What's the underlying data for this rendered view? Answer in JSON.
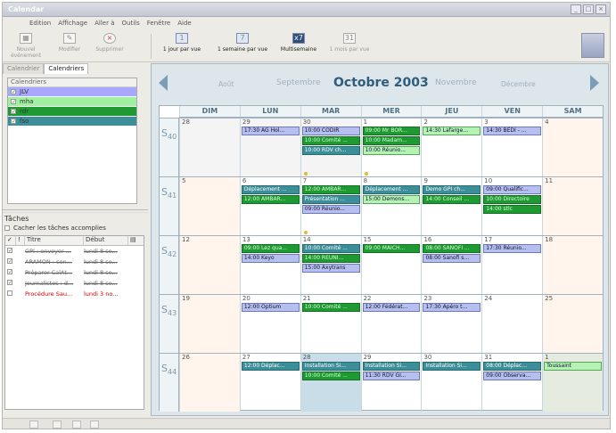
{
  "window": {
    "title": "Calendar"
  },
  "menu": [
    "Edition",
    "Affichage",
    "Aller à",
    "Outils",
    "Fenêtre",
    "Aide"
  ],
  "toolbar": {
    "new_event": "Nouvel événement",
    "modify": "Modifier",
    "delete": "Supprimer",
    "day_view": "1 jour par vue",
    "week_view": "1 semaine par vue",
    "multiweek": "Multisemaine",
    "month_view": "1 mois par vue"
  },
  "left_tabs": [
    "Calendrier",
    "Calendriers"
  ],
  "calendars": {
    "header": "Calendriers",
    "items": [
      {
        "name": "JLV",
        "color": "#a8a8ff",
        "checked": true
      },
      {
        "name": "mha",
        "color": "#9ff09f",
        "checked": true
      },
      {
        "name": "rdr",
        "color": "#1f9a33",
        "checked": true
      },
      {
        "name": "fso",
        "color": "#3c8f98",
        "checked": true
      }
    ]
  },
  "tasks": {
    "header": "Tâches",
    "hide_completed": "Cacher les tâches accomplies",
    "columns": {
      "priority": "!",
      "title": "Titre",
      "start": "Début"
    },
    "rows": [
      {
        "title": "GPI : envoyer ...",
        "start": "lundi 8 se...",
        "done": true,
        "late": false
      },
      {
        "title": "ARAMON : con...",
        "start": "lundi 8 se...",
        "done": true,
        "late": false
      },
      {
        "title": "Préparer CalAt...",
        "start": "lundi 8 se...",
        "done": true,
        "late": false
      },
      {
        "title": "Journalistes : d...",
        "start": "lundi 8 se...",
        "done": true,
        "late": false
      },
      {
        "title": "Procédure Sau...",
        "start": "lundi 3 no...",
        "done": false,
        "late": true
      }
    ]
  },
  "calendar": {
    "months": {
      "prev2": "Août",
      "prev1": "Septembre",
      "current": "Octobre 2003",
      "next1": "Novembre",
      "next2": "Décembre"
    },
    "days": [
      "DIM",
      "LUN",
      "MAR",
      "MER",
      "JEU",
      "VEN",
      "SAM"
    ],
    "weeks": [
      {
        "label": "S",
        "num": "40",
        "cells": [
          {
            "d": "28",
            "cls": "other",
            "ev": []
          },
          {
            "d": "29",
            "cls": "other",
            "ev": [
              {
                "t": "17:30 AG Hol...",
                "c": "b"
              }
            ]
          },
          {
            "d": "30",
            "cls": "other",
            "ev": [
              {
                "t": "10:00 CODIR",
                "c": "b"
              },
              {
                "t": "10:00 Comité ...",
                "c": "g"
              },
              {
                "t": "10:00 RDV ch...",
                "c": "t"
              }
            ],
            "dot": true
          },
          {
            "d": "1",
            "cls": "",
            "ev": [
              {
                "t": "09:00 Mr BOR...",
                "c": "g"
              },
              {
                "t": "10:00 Madam...",
                "c": "g"
              },
              {
                "t": "10:00 Réunio...",
                "c": "lg"
              }
            ],
            "dot": true
          },
          {
            "d": "2",
            "cls": "",
            "ev": [
              {
                "t": "14:30 Lafarge...",
                "c": "lg"
              }
            ]
          },
          {
            "d": "3",
            "cls": "",
            "ev": [
              {
                "t": "14:30 BEDI - ...",
                "c": "b"
              }
            ]
          },
          {
            "d": "4",
            "cls": "wknd",
            "ev": []
          }
        ]
      },
      {
        "label": "S",
        "num": "41",
        "cells": [
          {
            "d": "5",
            "cls": "wknd",
            "ev": []
          },
          {
            "d": "6",
            "cls": "",
            "ev": [
              {
                "t": "Déplacement ...",
                "c": "t"
              },
              {
                "t": "12:00 AMBAR...",
                "c": "g"
              }
            ]
          },
          {
            "d": "7",
            "cls": "",
            "ev": [
              {
                "t": "12:00 AMBAR...",
                "c": "g"
              },
              {
                "t": "Présentation ...",
                "c": "t"
              },
              {
                "t": "09:00 Réunio...",
                "c": "b"
              }
            ],
            "dot": true
          },
          {
            "d": "8",
            "cls": "",
            "ev": [
              {
                "t": "Déplacement ...",
                "c": "t"
              },
              {
                "t": "15:00 Demons...",
                "c": "lg"
              }
            ]
          },
          {
            "d": "9",
            "cls": "",
            "ev": [
              {
                "t": "Demo GPI ch...",
                "c": "t"
              },
              {
                "t": "14:00 Conseil ...",
                "c": "g"
              }
            ]
          },
          {
            "d": "10",
            "cls": "",
            "ev": [
              {
                "t": "09:00 Qualific...",
                "c": "b"
              },
              {
                "t": "10:00 Directoire",
                "c": "g"
              },
              {
                "t": "14:00 stlc",
                "c": "g"
              }
            ]
          },
          {
            "d": "11",
            "cls": "wknd",
            "ev": []
          }
        ]
      },
      {
        "label": "S",
        "num": "42",
        "cells": [
          {
            "d": "12",
            "cls": "wknd",
            "ev": []
          },
          {
            "d": "13",
            "cls": "",
            "ev": [
              {
                "t": "09:00 Lez qua...",
                "c": "g"
              },
              {
                "t": "14:00 Keyo",
                "c": "b"
              }
            ]
          },
          {
            "d": "14",
            "cls": "",
            "ev": [
              {
                "t": "10:00 Comité ...",
                "c": "t"
              },
              {
                "t": "14:00 RÉUNI...",
                "c": "g"
              },
              {
                "t": "15:00 Axytrans",
                "c": "b"
              }
            ]
          },
          {
            "d": "15",
            "cls": "",
            "ev": [
              {
                "t": "09:00 MAICH...",
                "c": "g"
              }
            ]
          },
          {
            "d": "16",
            "cls": "",
            "ev": [
              {
                "t": "08:00 SANOFI ...",
                "c": "g"
              },
              {
                "t": "08:00 Sanofi s...",
                "c": "b"
              }
            ]
          },
          {
            "d": "17",
            "cls": "",
            "ev": [
              {
                "t": "17:30 Réunio...",
                "c": "b"
              }
            ]
          },
          {
            "d": "18",
            "cls": "wknd",
            "ev": []
          }
        ]
      },
      {
        "label": "S",
        "num": "43",
        "cells": [
          {
            "d": "19",
            "cls": "wknd",
            "ev": []
          },
          {
            "d": "20",
            "cls": "",
            "ev": [
              {
                "t": "12:00 Optium",
                "c": "b"
              }
            ]
          },
          {
            "d": "21",
            "cls": "",
            "ev": [
              {
                "t": "10:00 Comité ...",
                "c": "g"
              }
            ]
          },
          {
            "d": "22",
            "cls": "",
            "ev": [
              {
                "t": "12:00 Fédérat...",
                "c": "b"
              }
            ]
          },
          {
            "d": "23",
            "cls": "",
            "ev": [
              {
                "t": "17:30 Apéro t...",
                "c": "b"
              }
            ]
          },
          {
            "d": "24",
            "cls": "",
            "ev": []
          },
          {
            "d": "25",
            "cls": "wknd",
            "ev": []
          }
        ]
      },
      {
        "label": "S",
        "num": "44",
        "cells": [
          {
            "d": "26",
            "cls": "wknd",
            "ev": []
          },
          {
            "d": "27",
            "cls": "",
            "ev": [
              {
                "t": "12:00 Déplac...",
                "c": "t"
              }
            ]
          },
          {
            "d": "28",
            "cls": "today",
            "ev": [
              {
                "t": "Installation Si...",
                "c": "t"
              },
              {
                "t": "10:00 Comité ...",
                "c": "g"
              }
            ]
          },
          {
            "d": "29",
            "cls": "",
            "ev": [
              {
                "t": "Installation Si...",
                "c": "t"
              },
              {
                "t": "11:30 RDV GI...",
                "c": "b"
              }
            ]
          },
          {
            "d": "30",
            "cls": "",
            "ev": [
              {
                "t": "Installation Si...",
                "c": "t"
              }
            ]
          },
          {
            "d": "31",
            "cls": "",
            "ev": [
              {
                "t": "08:00 Déplac...",
                "c": "t"
              },
              {
                "t": "09:00 Observa...",
                "c": "b"
              }
            ]
          },
          {
            "d": "1",
            "cls": "hl",
            "ev": [
              {
                "t": "Toussaint",
                "c": "lg"
              }
            ]
          }
        ]
      }
    ]
  }
}
